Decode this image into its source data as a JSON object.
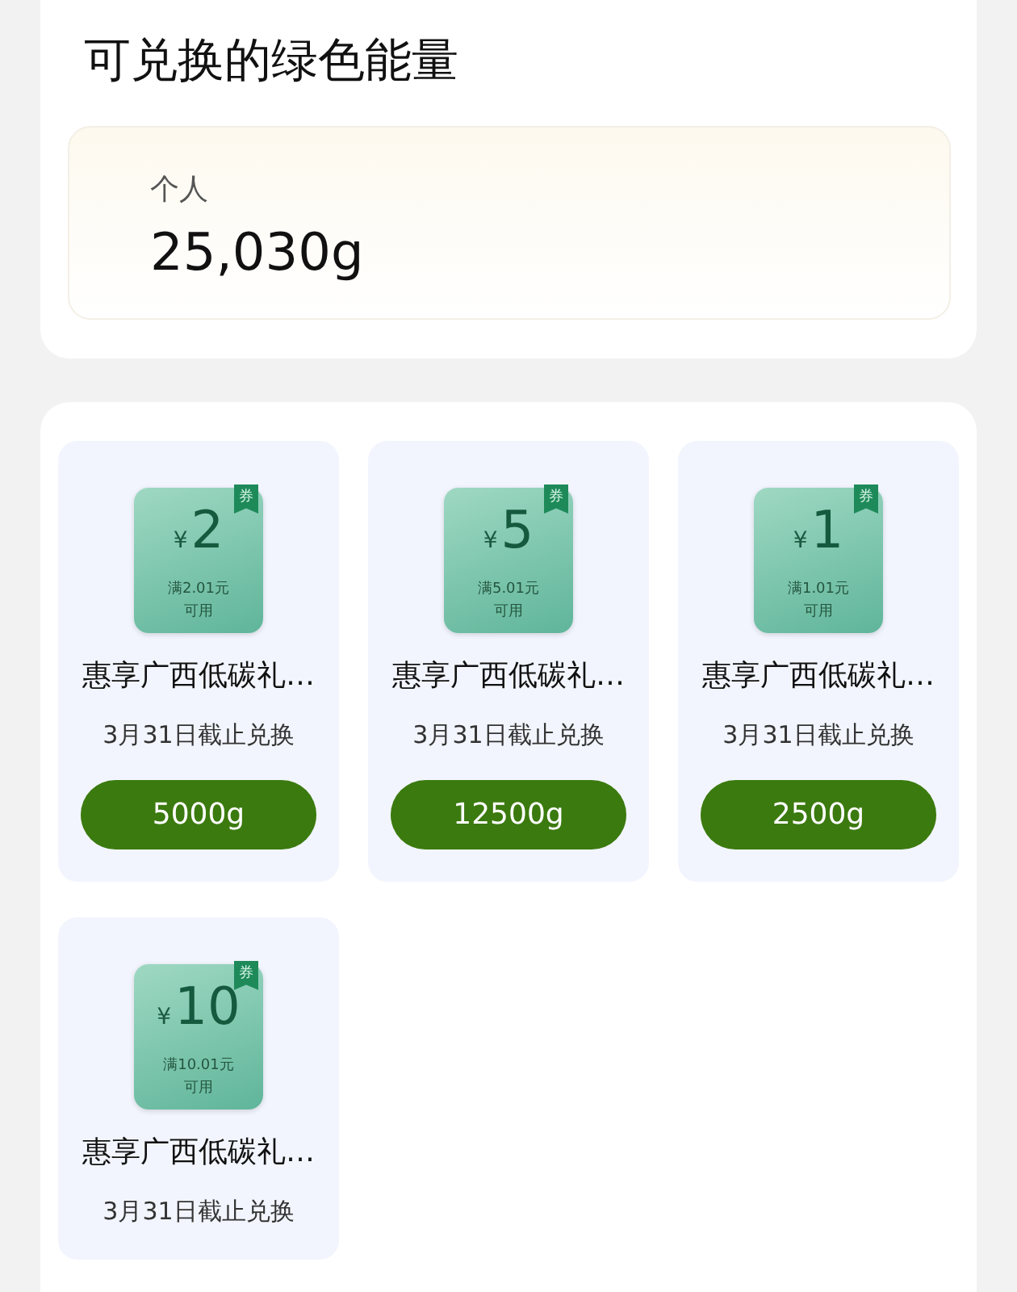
{
  "energy": {
    "title": "可兑换的绿色能量",
    "label": "个人",
    "amount": "25,030g"
  },
  "coupons": [
    {
      "currency": "¥",
      "value": "2",
      "tag": "券",
      "condition": "满2.01元",
      "usable": "可用",
      "title": "惠享广西低碳礼…",
      "deadline": "3月31日截止兑换",
      "price": "5000g"
    },
    {
      "currency": "¥",
      "value": "5",
      "tag": "券",
      "condition": "满5.01元",
      "usable": "可用",
      "title": "惠享广西低碳礼…",
      "deadline": "3月31日截止兑换",
      "price": "12500g"
    },
    {
      "currency": "¥",
      "value": "1",
      "tag": "券",
      "condition": "满1.01元",
      "usable": "可用",
      "title": "惠享广西低碳礼…",
      "deadline": "3月31日截止兑换",
      "price": "2500g"
    },
    {
      "currency": "¥",
      "value": "10",
      "tag": "券",
      "condition": "满10.01元",
      "usable": "可用",
      "title": "惠享广西低碳礼…",
      "deadline": "3月31日截止兑换"
    }
  ]
}
